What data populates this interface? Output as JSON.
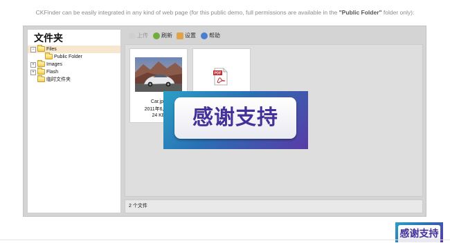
{
  "intro": {
    "text_before": "CKFinder can be easily integrated in any kind of web page (for this public demo, full permissions are available in the ",
    "highlight": "\"Public Folder\"",
    "text_after": " folder only):"
  },
  "sidebar": {
    "title": "文件夹",
    "tree": [
      {
        "label": "Files",
        "toggle": "−",
        "selected": true
      },
      {
        "label": "Public Folder"
      },
      {
        "label": "Images",
        "toggle": "+"
      },
      {
        "label": "Flash",
        "toggle": "+"
      },
      {
        "label": "临时文件夹"
      }
    ]
  },
  "toolbar": {
    "upload": "上传",
    "refresh": "刷新",
    "settings": "设置",
    "help": "帮助"
  },
  "files": [
    {
      "name": "Car.jpg",
      "date": "2011年6月27",
      "size": "24 KB",
      "type": "image"
    },
    {
      "name": "",
      "type": "pdf",
      "icon_label": "PDF"
    }
  ],
  "status": {
    "text": "2 个文件"
  },
  "overlay": {
    "banner_text": "感谢支持",
    "badge_text": "感谢支持"
  },
  "colors": {
    "tree_selected": "#f8e7cf",
    "banner_text": "#43309b"
  },
  "icons": {
    "upload": "upload-icon",
    "refresh": "refresh-icon",
    "settings": "settings-icon",
    "help": "help-icon",
    "folder": "folder-icon",
    "pdf": "pdf-icon"
  }
}
